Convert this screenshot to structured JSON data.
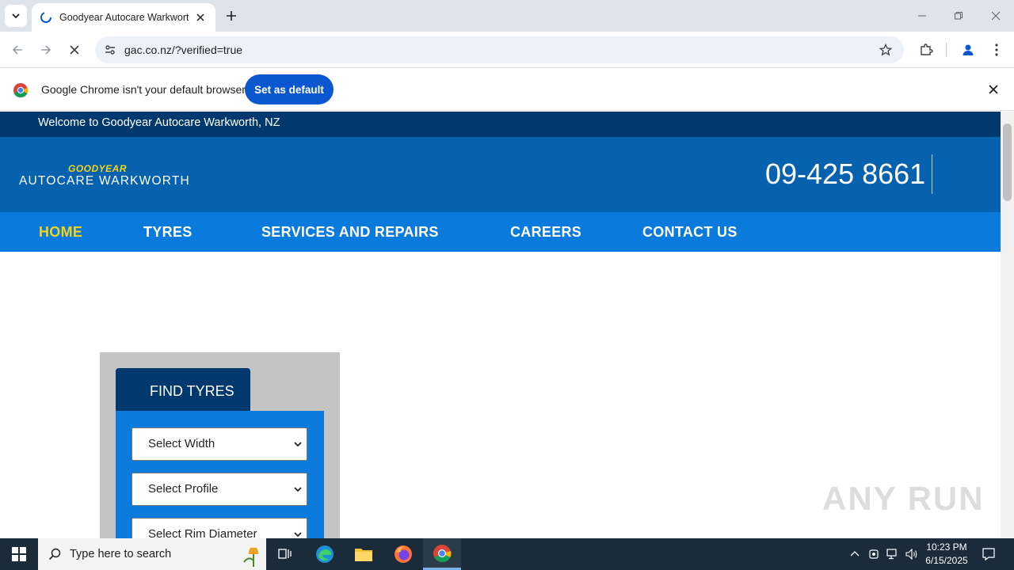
{
  "browser": {
    "tab_title": "Goodyear Autocare Warkworth",
    "url": "gac.co.nz/?verified=true",
    "infobar_text": "Google Chrome isn't your default browser",
    "set_default_label": "Set as default"
  },
  "site": {
    "welcome": "Welcome to Goodyear Autocare Warkworth, NZ",
    "logo_brand": "GOODYEAR",
    "logo_sub": "AUTOCARE WARKWORTH",
    "phone": "09-425 8661",
    "nav": [
      {
        "label": "HOME",
        "active": true
      },
      {
        "label": "TYRES",
        "active": false
      },
      {
        "label": "SERVICES AND REPAIRS",
        "active": false
      },
      {
        "label": "CAREERS",
        "active": false
      },
      {
        "label": "CONTACT US",
        "active": false
      }
    ],
    "finder": {
      "title": "FIND TYRES",
      "selects": [
        "Select Width",
        "Select Profile",
        "Select Rim Diameter"
      ]
    },
    "colors": {
      "topbar": "#01396e",
      "header": "#0661af",
      "nav": "#0a7bdc",
      "accent": "#f5d21a"
    }
  },
  "watermark": "ANY RUN",
  "taskbar": {
    "search_placeholder": "Type here to search",
    "time": "10:23 PM",
    "date": "6/15/2025"
  }
}
